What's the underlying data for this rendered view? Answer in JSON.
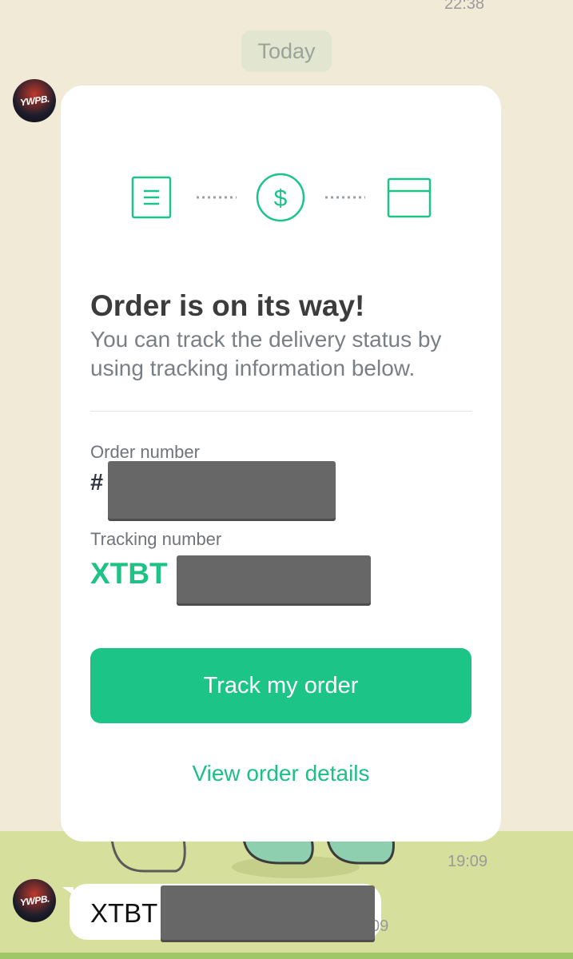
{
  "chat": {
    "prev_time": "22:38",
    "date_label": "Today",
    "sender_avatar_label": "YWPB."
  },
  "card": {
    "steps": [
      "document-icon",
      "dollar-icon",
      "box-icon"
    ],
    "accent_color": "#1dc487",
    "title": "Order is on its way!",
    "subtitle": "You can track the delivery status by using tracking information below.",
    "order_label": "Order number",
    "order_value": "#",
    "tracking_label": "Tracking number",
    "tracking_value": "XTBT",
    "track_button": "Track my order",
    "view_link": "View order details"
  },
  "message_time": "19:09",
  "next_message": {
    "text": "XTBT",
    "time_partial": "09"
  }
}
